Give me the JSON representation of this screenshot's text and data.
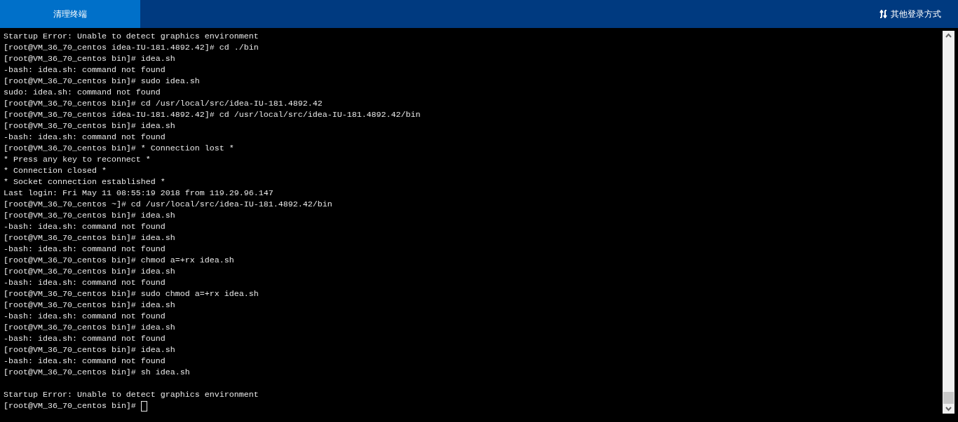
{
  "top_bar": {
    "tabs": [
      {
        "label": "清理终端",
        "selected": true
      }
    ],
    "alt_login": {
      "label": "其他登录方式"
    }
  },
  "terminal": {
    "cursor": true,
    "blocks": [
      [
        "Startup Error: Unable to detect graphics environment",
        "[root@VM_36_70_centos idea-IU-181.4892.42]# cd ./bin",
        "[root@VM_36_70_centos bin]# idea.sh",
        "-bash: idea.sh: command not found",
        "[root@VM_36_70_centos bin]# sudo idea.sh",
        "sudo: idea.sh: command not found",
        "[root@VM_36_70_centos bin]# cd /usr/local/src/idea-IU-181.4892.42",
        "[root@VM_36_70_centos idea-IU-181.4892.42]# cd /usr/local/src/idea-IU-181.4892.42/bin",
        "[root@VM_36_70_centos bin]# idea.sh",
        "-bash: idea.sh: command not found",
        "[root@VM_36_70_centos bin]# * Connection lost *",
        "* Press any key to reconnect *",
        "* Connection closed *",
        "* Socket connection established *",
        "Last login: Fri May 11 08:55:19 2018 from 119.29.96.147",
        "[root@VM_36_70_centos ~]# cd /usr/local/src/idea-IU-181.4892.42/bin",
        "[root@VM_36_70_centos bin]# idea.sh",
        "-bash: idea.sh: command not found",
        "[root@VM_36_70_centos bin]# idea.sh",
        "-bash: idea.sh: command not found",
        "[root@VM_36_70_centos bin]# chmod a=+rx idea.sh",
        "[root@VM_36_70_centos bin]# idea.sh",
        "-bash: idea.sh: command not found",
        "[root@VM_36_70_centos bin]# sudo chmod a=+rx idea.sh",
        "[root@VM_36_70_centos bin]# idea.sh",
        "-bash: idea.sh: command not found",
        "[root@VM_36_70_centos bin]# idea.sh",
        "-bash: idea.sh: command not found",
        "[root@VM_36_70_centos bin]# idea.sh",
        "-bash: idea.sh: command not found",
        "[root@VM_36_70_centos bin]# sh idea.sh"
      ],
      [
        "Startup Error: Unable to detect graphics environment",
        "[root@VM_36_70_centos bin]#"
      ]
    ]
  }
}
